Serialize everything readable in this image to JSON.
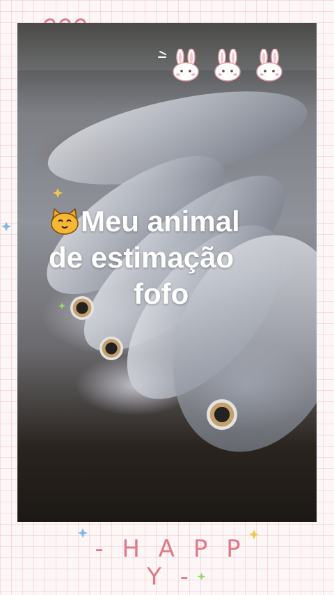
{
  "overlay": {
    "title_line1": "Meu animal",
    "title_line2": "de estimação",
    "title_line3": "fofo"
  },
  "footer": {
    "happy_text": "- H A P P Y -"
  },
  "icons": {
    "title": "cat-face-icon",
    "top_decoration": "rabbit-face-icon",
    "corner_decoration": "spiral-icon",
    "sparkles": "star-icon"
  },
  "colors": {
    "accent_pink": "#e07a86",
    "grid_pink": "#e8aab4",
    "star_yellow": "#f2c94c",
    "star_blue": "#7fb8e8",
    "star_green": "#9ad66a"
  }
}
